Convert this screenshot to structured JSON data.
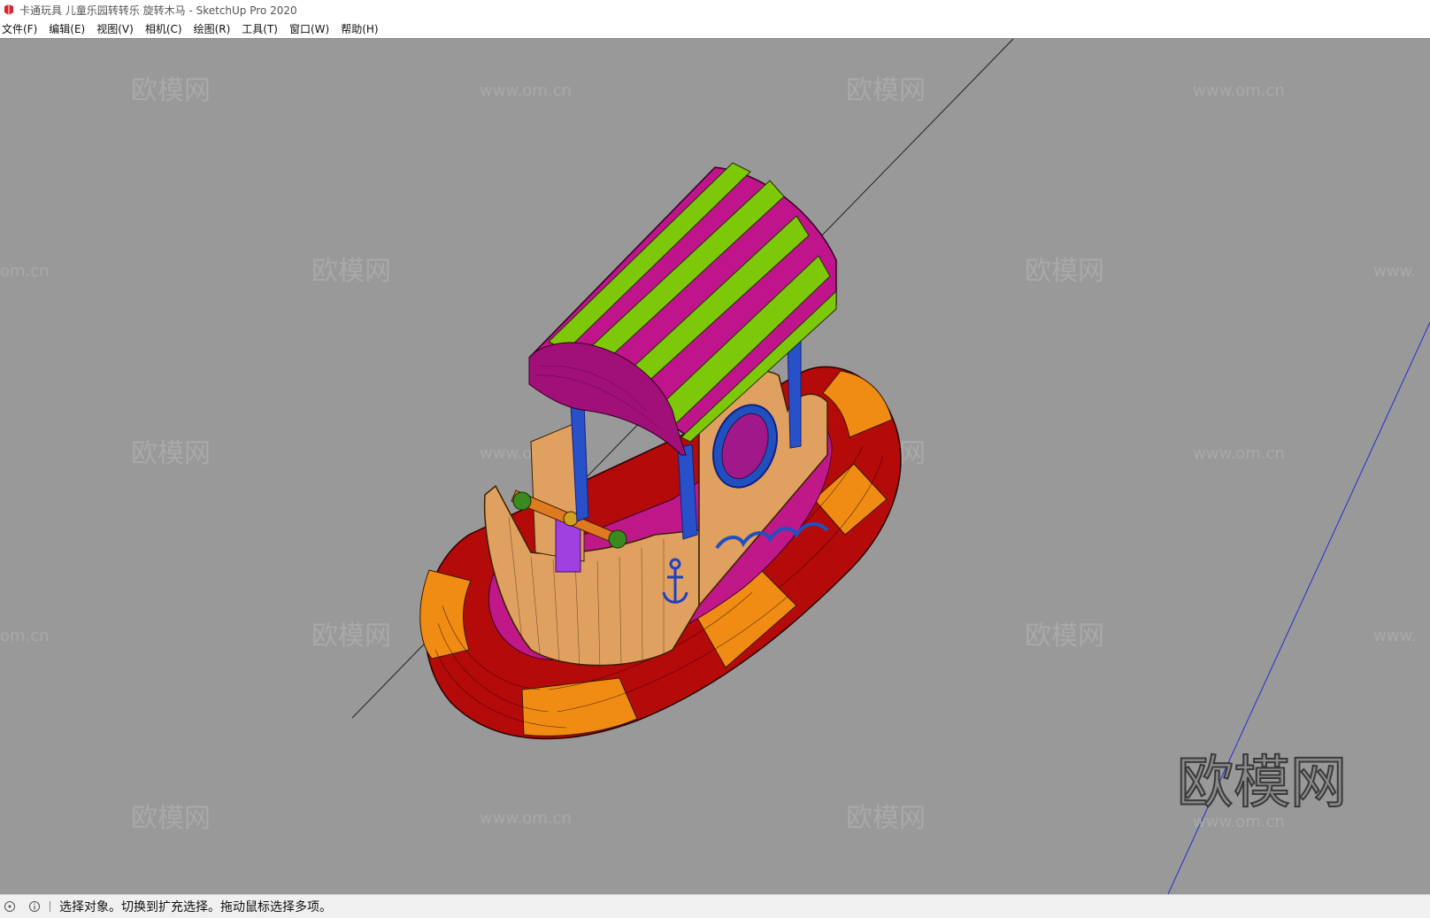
{
  "window": {
    "title": "卡通玩具 儿童乐园转转乐 旋转木马 - SketchUp Pro 2020"
  },
  "menu": {
    "items": [
      "文件(F)",
      "编辑(E)",
      "视图(V)",
      "相机(C)",
      "绘图(R)",
      "工具(T)",
      "窗口(W)",
      "帮助(H)"
    ]
  },
  "viewport": {
    "background_color": "#999999",
    "watermarks": {
      "brand_text": "欧模网",
      "url_text": "www.om.cn",
      "url_partial_left": "om.cn",
      "url_partial_right": "www."
    },
    "model": {
      "colors": {
        "canopy_magenta": "#c0148c",
        "canopy_green": "#7ec80a",
        "ring_red": "#b40a0a",
        "ring_orange": "#f08c14",
        "hull_tan": "#e0a060",
        "pillar_blue": "#2850c8",
        "seat_purple": "#a040e0"
      }
    }
  },
  "status": {
    "message": "选择对象。切换到扩充选择。拖动鼠标选择多项。"
  }
}
